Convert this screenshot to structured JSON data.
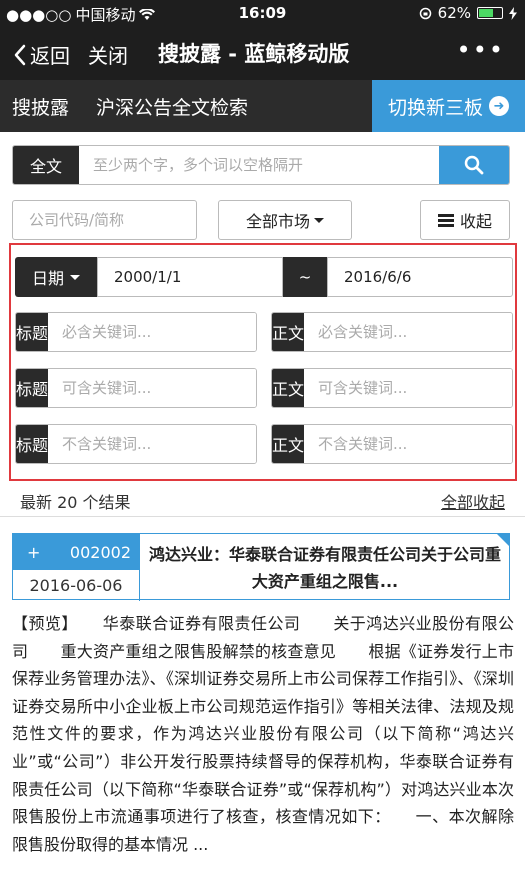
{
  "status_bar": {
    "signal": "●●●○○",
    "carrier": "中国移动",
    "time": "16:09",
    "battery": "62%",
    "battery_level": 0.62
  },
  "nav": {
    "back_label": "返回",
    "close_label": "关闭",
    "title": "搜披露 - 蓝鲸移动版",
    "more": "•••"
  },
  "header": {
    "brand": "搜披露",
    "subtitle": "沪深公告全文检索",
    "switch_label": "切换新三板"
  },
  "search": {
    "fulltext_label": "全文",
    "fulltext_placeholder": "至少两个字，多个词以空格隔开",
    "code_placeholder": "公司代码/简称",
    "market_label": "全部市场",
    "collapse_label": "收起"
  },
  "advanced": {
    "date_label": "日期",
    "date_from": "2000/1/1",
    "date_sep": "~",
    "date_to": "2016/6/6",
    "rows": [
      {
        "left_label": "标题",
        "left_placeholder": "必含关键词...",
        "right_label": "正文",
        "right_placeholder": "必含关键词..."
      },
      {
        "left_label": "标题",
        "left_placeholder": "可含关键词...",
        "right_label": "正文",
        "right_placeholder": "可含关键词..."
      },
      {
        "left_label": "标题",
        "left_placeholder": "不含关键词...",
        "right_label": "正文",
        "right_placeholder": "不含关键词..."
      }
    ]
  },
  "results": {
    "count_text": "最新 20 个结果",
    "collapse_all": "全部收起",
    "items": [
      {
        "plus": "+",
        "code": "002002",
        "date": "2016-06-06",
        "title": "鸿达兴业：华泰联合证券有限责任公司关于公司重大资产重组之限售...",
        "preview": "【预览】　　华泰联合证券有限责任公司　　关于鸿达兴业股份有限公司　　重大资产重组之限售股解禁的核查意见　　根据《证券发行上市保荐业务管理办法》、《深圳证券交易所上市公司保荐工作指引》、《深圳证券交易所中小企业板上市公司规范运作指引》等相关法律、法规及规范性文件的要求，作为鸿达兴业股份有限公司（以下简称“鸿达兴业”或“公司”）非公开发行股票持续督导的保荐机构，华泰联合证券有限责任公司（以下简称“华泰联合证券”或“保荐机构”）对鸿达兴业本次限售股份上市流通事项进行了核查，核查情况如下：　　一、本次解除限售股份取得的基本情况 ..."
      }
    ]
  },
  "colors": {
    "dark": "#1e1e1e",
    "accent": "#3a9ad9",
    "highlight_border": "#e0393e"
  }
}
